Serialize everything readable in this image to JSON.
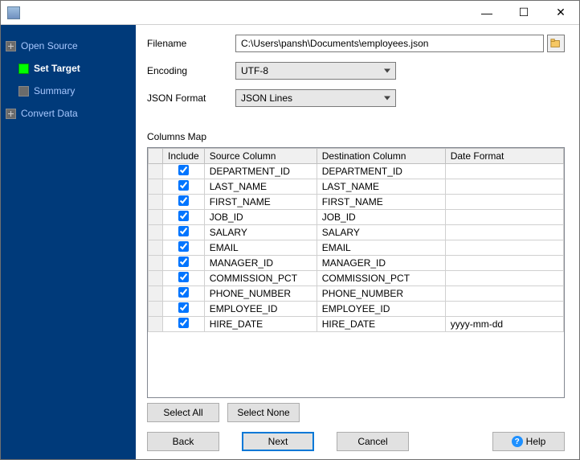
{
  "titlebar": {
    "minimize_glyph": "—",
    "maximize_glyph": "☐",
    "close_glyph": "✕"
  },
  "sidebar": {
    "items": [
      {
        "label": "Open Source",
        "level": 1,
        "active": false
      },
      {
        "label": "Set Target",
        "level": 2,
        "active": true
      },
      {
        "label": "Summary",
        "level": 2,
        "active": false
      },
      {
        "label": "Convert Data",
        "level": 1,
        "active": false
      }
    ]
  },
  "form": {
    "filename_label": "Filename",
    "filename_value": "C:\\Users\\pansh\\Documents\\employees.json",
    "encoding_label": "Encoding",
    "encoding_value": "UTF-8",
    "jsonformat_label": "JSON Format",
    "jsonformat_value": "JSON Lines",
    "columnsmap_label": "Columns Map"
  },
  "grid": {
    "headers": {
      "include": "Include",
      "source": "Source Column",
      "dest": "Destination Column",
      "datefmt": "Date Format"
    },
    "rows": [
      {
        "include": true,
        "source": "DEPARTMENT_ID",
        "dest": "DEPARTMENT_ID",
        "datefmt": ""
      },
      {
        "include": true,
        "source": "LAST_NAME",
        "dest": "LAST_NAME",
        "datefmt": ""
      },
      {
        "include": true,
        "source": "FIRST_NAME",
        "dest": "FIRST_NAME",
        "datefmt": ""
      },
      {
        "include": true,
        "source": "JOB_ID",
        "dest": "JOB_ID",
        "datefmt": ""
      },
      {
        "include": true,
        "source": "SALARY",
        "dest": "SALARY",
        "datefmt": ""
      },
      {
        "include": true,
        "source": "EMAIL",
        "dest": "EMAIL",
        "datefmt": ""
      },
      {
        "include": true,
        "source": "MANAGER_ID",
        "dest": "MANAGER_ID",
        "datefmt": ""
      },
      {
        "include": true,
        "source": "COMMISSION_PCT",
        "dest": "COMMISSION_PCT",
        "datefmt": ""
      },
      {
        "include": true,
        "source": "PHONE_NUMBER",
        "dest": "PHONE_NUMBER",
        "datefmt": ""
      },
      {
        "include": true,
        "source": "EMPLOYEE_ID",
        "dest": "EMPLOYEE_ID",
        "datefmt": ""
      },
      {
        "include": true,
        "source": "HIRE_DATE",
        "dest": "HIRE_DATE",
        "datefmt": "yyyy-mm-dd"
      }
    ]
  },
  "buttons": {
    "select_all": "Select All",
    "select_none": "Select None",
    "back": "Back",
    "next": "Next",
    "cancel": "Cancel",
    "help": "Help"
  }
}
